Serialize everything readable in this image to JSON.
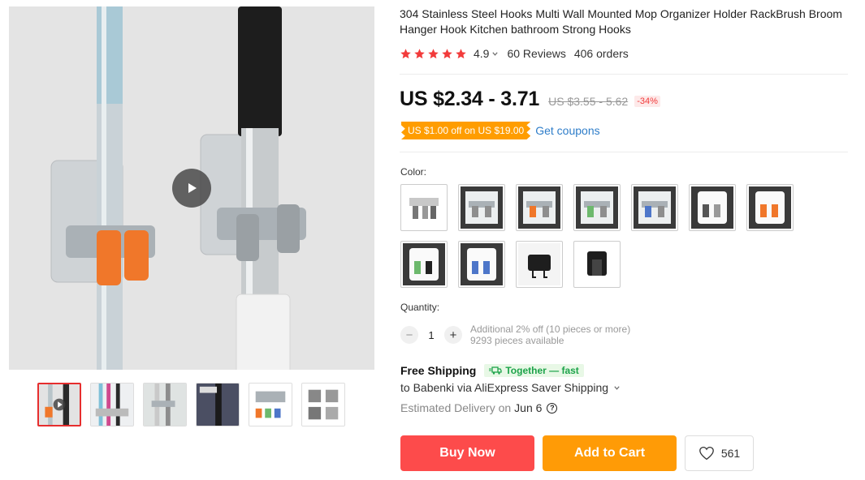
{
  "product": {
    "title": "304 Stainless Steel Hooks Multi Wall Mounted Mop Organizer Holder RackBrush Broom Hanger Hook Kitchen bathroom Strong Hooks",
    "rating": "4.9",
    "reviews": "60 Reviews",
    "orders": "406 orders"
  },
  "price": {
    "current": "US $2.34 - 3.71",
    "original": "US $3.55 - 5.62",
    "discount": "-34%"
  },
  "coupon": {
    "tag": "US $1.00 off on US $19.00",
    "link": "Get coupons"
  },
  "color": {
    "label": "Color:",
    "options_count": 11
  },
  "quantity": {
    "label": "Quantity:",
    "value": "1",
    "minus": "−",
    "plus": "+",
    "note1": "Additional 2% off (10 pieces or more)",
    "note2": "9293 pieces available"
  },
  "shipping": {
    "free": "Free Shipping",
    "badge": "Together — fast",
    "destination": "to Babenki via AliExpress Saver Shipping",
    "estimate_label": "Estimated Delivery on",
    "estimate_date": "Jun 6",
    "help": "?"
  },
  "actions": {
    "buy": "Buy Now",
    "cart": "Add to Cart",
    "wishlist_count": "561"
  },
  "colors": {
    "accent_red": "#fd4b4b",
    "accent_orange": "#ff9b06",
    "star": "#f23b3b",
    "link": "#2e7dc9"
  }
}
